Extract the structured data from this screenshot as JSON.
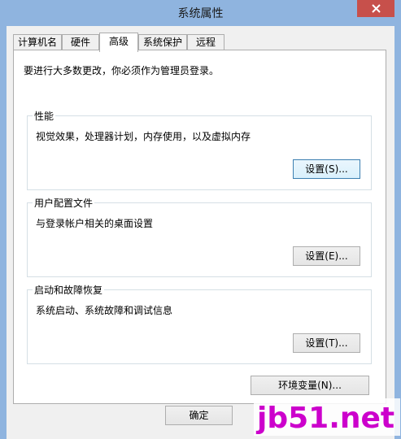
{
  "window": {
    "title": "系统属性"
  },
  "tabs": [
    {
      "label": "计算机名"
    },
    {
      "label": "硬件"
    },
    {
      "label": "高级"
    },
    {
      "label": "系统保护"
    },
    {
      "label": "远程"
    }
  ],
  "admin_note": "要进行大多数更改，你必须作为管理员登录。",
  "performance": {
    "title": "性能",
    "description": "视觉效果，处理器计划，内存使用，以及虚拟内存",
    "button": "设置(S)..."
  },
  "user_profiles": {
    "title": "用户配置文件",
    "description": "与登录帐户相关的桌面设置",
    "button": "设置(E)..."
  },
  "startup_recovery": {
    "title": "启动和故障恢复",
    "description": "系统启动、系统故障和调试信息",
    "button": "设置(T)..."
  },
  "env_vars_button": "环境变量(N)...",
  "ok_button": "确定",
  "watermark": "jb51.net",
  "colors": {
    "titlebar": "#8fb4df",
    "close": "#c7504b",
    "watermark": "#cc00cc"
  }
}
